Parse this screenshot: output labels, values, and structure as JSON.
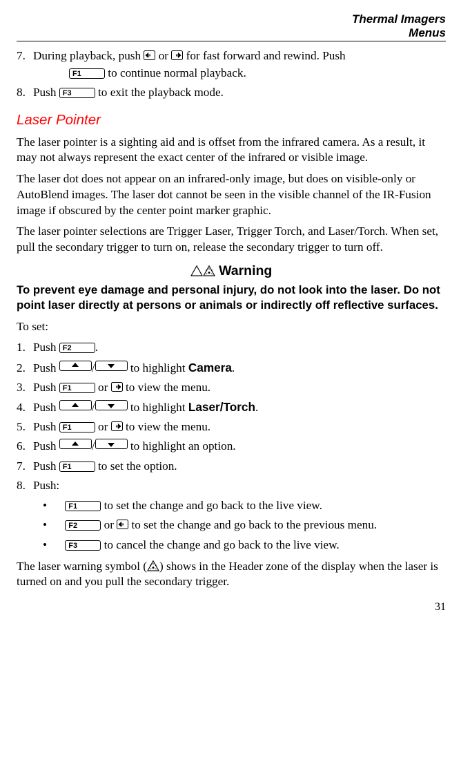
{
  "header": {
    "line1": "Thermal Imagers",
    "line2": "Menus"
  },
  "intro_steps": [
    {
      "num": "7.",
      "before": "During playback, push ",
      "mid": " or ",
      "after": " for fast forward and rewind. Push",
      "cont_after": " to continue normal playback.",
      "key_cont": "F1"
    },
    {
      "num": "8.",
      "before": "Push ",
      "key": "F3",
      "after": " to exit the playback mode."
    }
  ],
  "section": {
    "title": "Laser Pointer",
    "p1": "The laser pointer is a sighting aid and is offset from the infrared camera. As a result, it may not always represent the exact center of the infrared or visible image.",
    "p2": "The laser dot does not appear on an infrared-only image, but does on visible-only or AutoBlend images. The laser dot cannot be seen in the visible channel of the IR-Fusion image if obscured by the center point marker graphic.",
    "p3": "The laser pointer selections are Trigger Laser, Trigger Torch, and Laser/Torch. When set, pull the secondary trigger to turn on, release the secondary trigger to turn off."
  },
  "warning": {
    "heading": "Warning",
    "body": "To prevent eye damage and personal injury, do not look into the laser. Do not point laser directly at persons or animals or indirectly off reflective surfaces."
  },
  "toset": "To set:",
  "steps": [
    {
      "num": "1.",
      "pre": "Push ",
      "key": "F2",
      "post": "."
    },
    {
      "num": "2.",
      "pre": "Push ",
      "mid": "/",
      "post": " to highlight ",
      "hl": "Camera",
      "end": "."
    },
    {
      "num": "3.",
      "pre": "Push ",
      "key": "F1",
      "mid": " or ",
      "post": " to view the menu."
    },
    {
      "num": "4.",
      "pre": "Push ",
      "mid": "/",
      "post": " to highlight ",
      "hl": "Laser/Torch",
      "end": "."
    },
    {
      "num": "5.",
      "pre": "Push ",
      "key": "F1",
      "mid": " or ",
      "post": " to view the menu."
    },
    {
      "num": "6.",
      "pre": "Push ",
      "mid": "/",
      "post": " to highlight an option."
    },
    {
      "num": "7.",
      "pre": "Push ",
      "key": "F1",
      "post": " to set the option."
    },
    {
      "num": "8.",
      "pre": "Push:"
    }
  ],
  "bullets": [
    {
      "key": "F1",
      "post": " to set the change and go back to the live view."
    },
    {
      "key": "F2",
      "mid": " or ",
      "post": " to set the change and go back to the previous menu."
    },
    {
      "key": "F3",
      "post": " to cancel the change and go back to the live view."
    }
  ],
  "closing": {
    "a": "The laser warning symbol (",
    "b": ") shows in the Header zone of the display when the laser is turned on and you pull the secondary trigger."
  },
  "pagenum": "31"
}
